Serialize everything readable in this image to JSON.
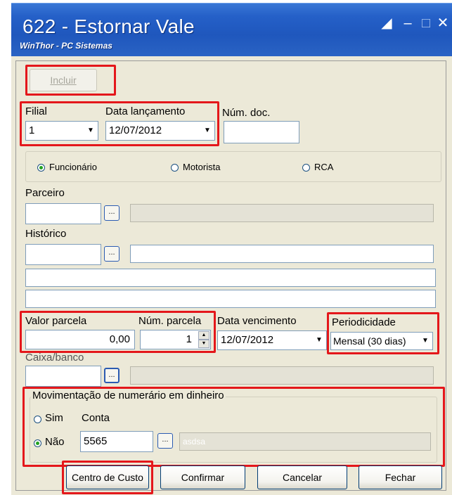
{
  "window": {
    "title": "622 - Estornar Vale",
    "subtitle": "WinThor - PC Sistemas"
  },
  "toolbar": {
    "incluir_label": "Incluir"
  },
  "filial": {
    "label": "Filial",
    "value": "1"
  },
  "data_lancamento": {
    "label": "Data lançamento",
    "value": "12/07/2012"
  },
  "num_doc": {
    "label": "Núm. doc.",
    "value": ""
  },
  "tipo": {
    "options": [
      "Funcionário",
      "Motorista",
      "RCA"
    ],
    "selected": "Funcionário"
  },
  "parceiro": {
    "label": "Parceiro",
    "code": "",
    "button": "..."
  },
  "historico": {
    "label": "Histórico",
    "code": "",
    "button": "...",
    "line1": "",
    "line2": ""
  },
  "valor_parcela": {
    "label": "Valor parcela",
    "value": "0,00"
  },
  "num_parcela": {
    "label": "Núm. parcela",
    "value": "1"
  },
  "data_vencimento": {
    "label": "Data vencimento",
    "value": "12/07/2012"
  },
  "periodicidade": {
    "label": "Periodicidade",
    "value": "Mensal (30 dias)"
  },
  "caixa_banco": {
    "label": "Caixa/banco",
    "code": "",
    "button": "..."
  },
  "movimentacao": {
    "legend": "Movimentação de numerário em dinheiro",
    "sim_label": "Sim",
    "nao_label": "Não",
    "selected": "Não",
    "conta_label": "Conta",
    "conta_value": "5565",
    "conta_button": "...",
    "conta_desc": "asdsa"
  },
  "buttons": {
    "centro_custo": "Centro de Custo",
    "confirmar": "Confirmar",
    "cancelar": "Cancelar",
    "fechar": "Fechar"
  },
  "colors": {
    "titlebar": "#2560c8",
    "face": "#ece9d8",
    "highlight_box": "#e4171b"
  }
}
